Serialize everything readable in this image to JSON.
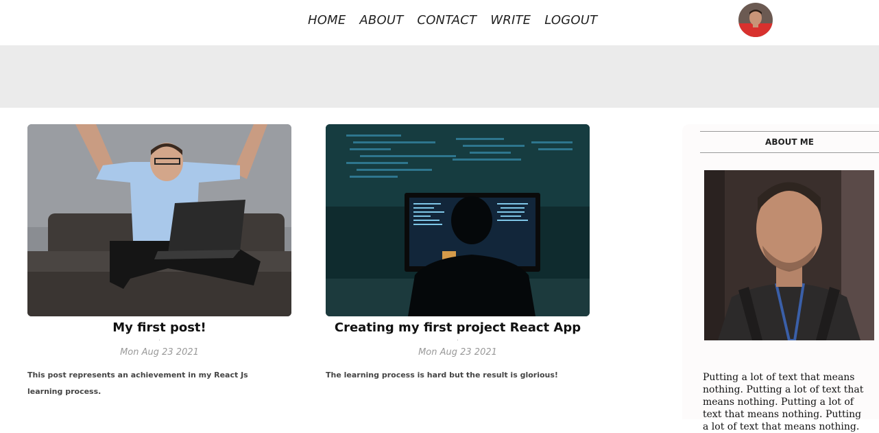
{
  "nav": {
    "items": [
      {
        "label": "HOME"
      },
      {
        "label": "ABOUT"
      },
      {
        "label": "CONTACT"
      },
      {
        "label": "WRITE"
      },
      {
        "label": "LOGOUT"
      }
    ]
  },
  "posts": [
    {
      "title": "My first post!",
      "dot": ".",
      "date": "Mon Aug 23 2021",
      "desc": "This post represents an achievement in my React Js learning process."
    },
    {
      "title": "Creating my first project React App",
      "dot": ".",
      "date": "Mon Aug 23 2021",
      "desc": "The learning process is hard but the result is glorious!"
    }
  ],
  "sidebar": {
    "title": "ABOUT ME",
    "text": "Putting a lot of text that means nothing. Putting a lot of text that means nothing. Putting a lot of text that means nothing. Putting a lot of text that means nothing."
  },
  "colors": {
    "banner": "#ebebeb",
    "sidebar_bg": "#fdfbfb"
  },
  "icons": {
    "avatar": "user-avatar-photo"
  }
}
